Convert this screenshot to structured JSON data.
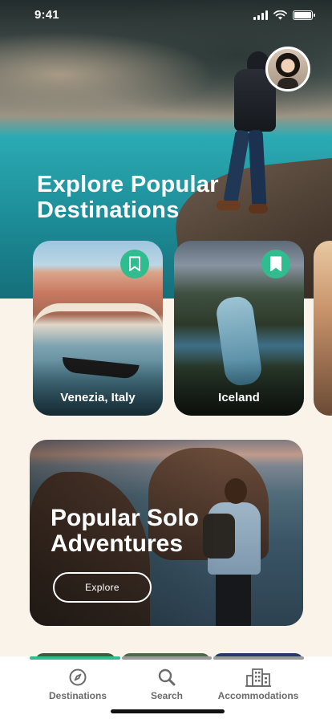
{
  "status_bar": {
    "time": "9:41"
  },
  "hero": {
    "title": "Explore Popular Destinations"
  },
  "destinations": [
    {
      "label": "Venezia, Italy",
      "bookmarked": true
    },
    {
      "label": "Iceland",
      "bookmarked": true
    }
  ],
  "solo": {
    "title": "Popular Solo Adventures",
    "button_label": "Explore"
  },
  "tabs": [
    {
      "label": "Destinations",
      "icon": "compass-icon",
      "active": true
    },
    {
      "label": "Search",
      "icon": "search-icon",
      "active": false
    },
    {
      "label": "Accommodations",
      "icon": "building-icon",
      "active": false
    }
  ],
  "colors": {
    "accent": "#2fbd8f",
    "background": "#faf3ea",
    "tab_text": "#6b6b6b",
    "inactive_indicator": "#9a9a9a"
  }
}
